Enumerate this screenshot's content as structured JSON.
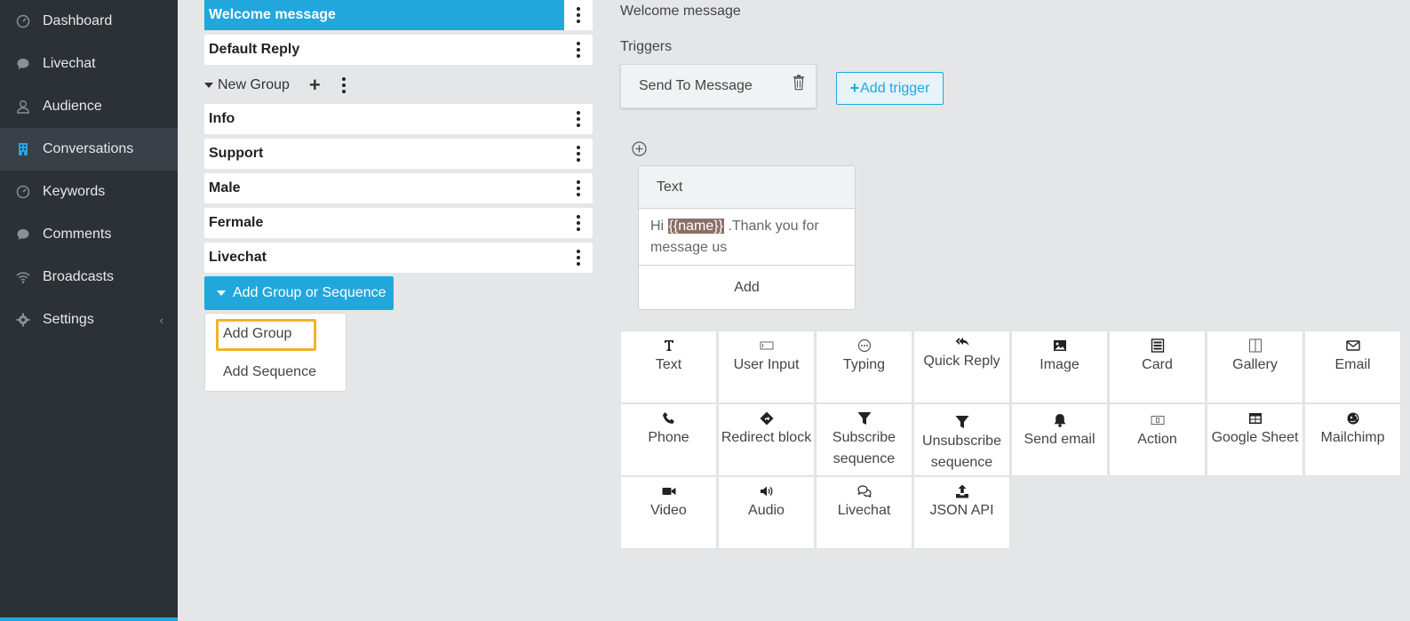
{
  "sidebar": {
    "items": [
      {
        "label": "Dashboard",
        "icon": "gauge-icon"
      },
      {
        "label": "Livechat",
        "icon": "chat-bubble-icon"
      },
      {
        "label": "Audience",
        "icon": "user-icon"
      },
      {
        "label": "Conversations",
        "icon": "building-icon"
      },
      {
        "label": "Keywords",
        "icon": "gauge-icon"
      },
      {
        "label": "Comments",
        "icon": "chat-bubble-icon"
      },
      {
        "label": "Broadcasts",
        "icon": "wifi-icon"
      },
      {
        "label": "Settings",
        "icon": "gear-icon"
      }
    ],
    "active": "Conversations",
    "settings_chevron": "‹"
  },
  "groups": {
    "top": [
      {
        "label": "Welcome message"
      },
      {
        "label": "Default Reply"
      }
    ],
    "new_group_label": "New Group",
    "new_group_items": [
      {
        "label": "Info"
      },
      {
        "label": "Support"
      },
      {
        "label": "Male"
      },
      {
        "label": "Fermale"
      },
      {
        "label": "Livechat"
      }
    ],
    "add_button_label": "Add Group or Sequence",
    "dropdown": {
      "add_group": "Add Group",
      "add_sequence": "Add Sequence"
    }
  },
  "editor": {
    "title": "Welcome message",
    "triggers_label": "Triggers",
    "trigger_name": "Send To Message",
    "add_trigger_label": "Add trigger",
    "text_card": {
      "header": "Text",
      "body_prefix": "Hi ",
      "body_variable": "{{name}}",
      "body_suffix": " .Thank you for message us",
      "add_label": "Add"
    }
  },
  "blocks": [
    {
      "label": "Text",
      "icon": "text-icon"
    },
    {
      "label": "User Input",
      "icon": "input-icon"
    },
    {
      "label": "Typing",
      "icon": "typing-icon"
    },
    {
      "label": "Quick Reply",
      "icon": "reply-all-icon"
    },
    {
      "label": "Image",
      "icon": "image-icon"
    },
    {
      "label": "Card",
      "icon": "card-icon"
    },
    {
      "label": "Gallery",
      "icon": "gallery-icon"
    },
    {
      "label": "Email",
      "icon": "envelope-icon"
    },
    {
      "label": "Phone",
      "icon": "phone-icon"
    },
    {
      "label": "Redirect block",
      "icon": "redirect-icon"
    },
    {
      "label": "Subscribe sequence",
      "icon": "filter-icon"
    },
    {
      "label": "Unsubscribe sequence",
      "icon": "filter-icon"
    },
    {
      "label": "Send email",
      "icon": "bell-icon"
    },
    {
      "label": "Action",
      "icon": "action-icon"
    },
    {
      "label": "Google Sheet",
      "icon": "table-icon"
    },
    {
      "label": "Mailchimp",
      "icon": "mailchimp-icon"
    },
    {
      "label": "Video",
      "icon": "video-icon"
    },
    {
      "label": "Audio",
      "icon": "speaker-icon"
    },
    {
      "label": "Livechat",
      "icon": "chat-icon"
    },
    {
      "label": "JSON API",
      "icon": "upload-icon"
    }
  ],
  "colors": {
    "accent": "#22a7dc",
    "sidebar_bg": "#2c3136",
    "highlight": "#f0b429",
    "variable_bg": "#8b6f66"
  }
}
